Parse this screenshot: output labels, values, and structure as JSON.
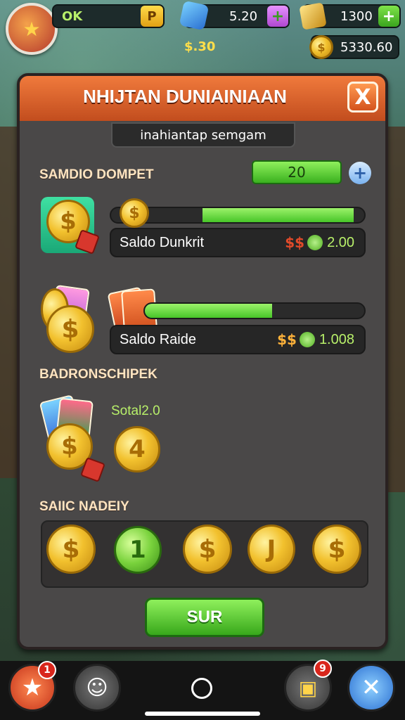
{
  "hud": {
    "ok_label": "OK",
    "ok_button": "P",
    "gems_value": "5.20",
    "gold_value": "1300",
    "sub_amount": "$.30",
    "coins_value": "5330.60"
  },
  "panel": {
    "title": "NHIJTAN DUNIAINIAAN",
    "close_label": "X",
    "subtitle": "inahiantap semgam",
    "section_wallet": "SAMDIO DOMPET",
    "wallet_pill_value": "20",
    "row1": {
      "label": "Saldo Dunkrit",
      "dollars": "$$",
      "amount": "2.00",
      "progress": 0.62
    },
    "row2": {
      "label": "Saldo Raide",
      "dollars": "$$",
      "amount": "1.008",
      "progress": 0.58
    },
    "section_bonus": "BADRONSCHIPEK",
    "bonus_total": "Sotal2.0",
    "bonus_coin_label": "4",
    "section_coins": "SAIIC NADEIY",
    "coins": [
      "$",
      "1",
      "$",
      "J",
      "$"
    ],
    "primary_button": "SUR"
  },
  "bottom": {
    "badge_left": "1",
    "badge_right": "9"
  },
  "colors": {
    "accent_orange": "#e5642a",
    "accent_green": "#47c528",
    "panel_bg": "#4a4848"
  }
}
